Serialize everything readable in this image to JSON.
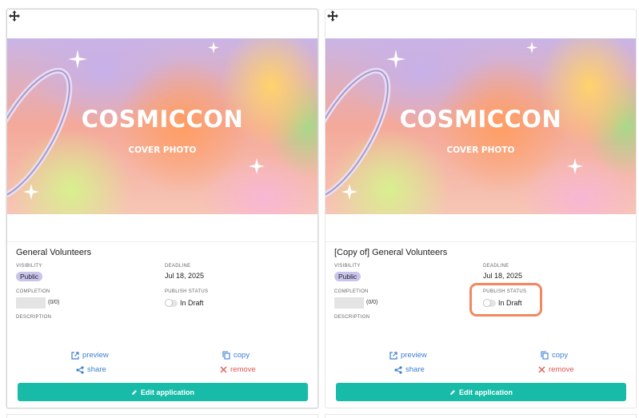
{
  "cards": [
    {
      "cover_title": "COSMICCON",
      "cover_subtitle": "COVER PHOTO",
      "name": "General Volunteers",
      "visibility_label": "VISIBILITY",
      "visibility_value": "Public",
      "deadline_label": "DEADLINE",
      "deadline_value": "Jul 18, 2025",
      "completion_label": "COMPLETION",
      "completion_count": "(0/0)",
      "completion_progress": 0,
      "publish_label": "PUBLISH STATUS",
      "publish_value": "In Draft",
      "publish_on": false,
      "description_label": "DESCRIPTION",
      "preview_label": "preview",
      "copy_label": "copy",
      "share_label": "share",
      "remove_label": "remove",
      "edit_label": "Edit application"
    },
    {
      "cover_title": "COSMICCON",
      "cover_subtitle": "COVER PHOTO",
      "name": "[Copy of] General Volunteers",
      "visibility_label": "VISIBILITY",
      "visibility_value": "Public",
      "deadline_label": "DEADLINE",
      "deadline_value": "Jul 18, 2025",
      "completion_label": "COMPLETION",
      "completion_count": "(0/0)",
      "completion_progress": 0,
      "publish_label": "PUBLISH STATUS",
      "publish_value": "In Draft",
      "publish_on": false,
      "description_label": "DESCRIPTION",
      "preview_label": "preview",
      "copy_label": "copy",
      "share_label": "share",
      "remove_label": "remove",
      "edit_label": "Edit application"
    }
  ],
  "colors": {
    "accent": "#17bba8",
    "link": "#3d7fd1",
    "danger": "#e0554f",
    "badge": "#c8c4ec",
    "highlight": "#f3875f"
  },
  "icons": [
    "drag-handle-icon",
    "external-link-icon",
    "copy-icon",
    "share-icon",
    "close-icon",
    "pencil-icon"
  ]
}
